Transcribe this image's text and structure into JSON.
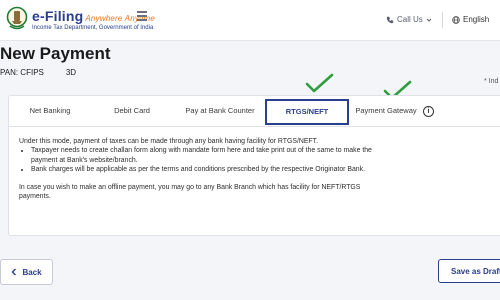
{
  "header": {
    "logo_title": "e-Filing",
    "logo_tagline": "Anywhere Anytime",
    "logo_subtitle": "Income Tax Department, Government of India",
    "call_us": "Call Us",
    "language": "English"
  },
  "page": {
    "title": "New Payment",
    "pan_label": "PAN: CFIPS",
    "pan_suffix": "3D",
    "required_note": "* Ind"
  },
  "tabs": [
    {
      "label": "Net Banking"
    },
    {
      "label": "Debit Card"
    },
    {
      "label": "Pay at Bank Counter"
    },
    {
      "label": "RTGS/NEFT"
    },
    {
      "label": "Payment Gateway"
    }
  ],
  "active_tab": "RTGS/NEFT",
  "content": {
    "intro": "Under this mode, payment of taxes can be made through any bank having facility for RTGS/NEFT.",
    "bullets": [
      "Taxpayer needs to create challan form along with mandate form here and take print out of the same to make the payment at Bank's website/branch.",
      "Bank charges will be applicable as per the terms and conditions prescribed by the respective Originator Bank."
    ],
    "offline_note": "In case you wish to make an offline payment, you may go to any Bank Branch which has facility for NEFT/RTGS payments."
  },
  "buttons": {
    "back": "Back",
    "save_draft": "Save as Draft"
  },
  "colors": {
    "brand": "#2a3d8f",
    "check": "#2e9e3e",
    "tagline": "#e87722"
  }
}
